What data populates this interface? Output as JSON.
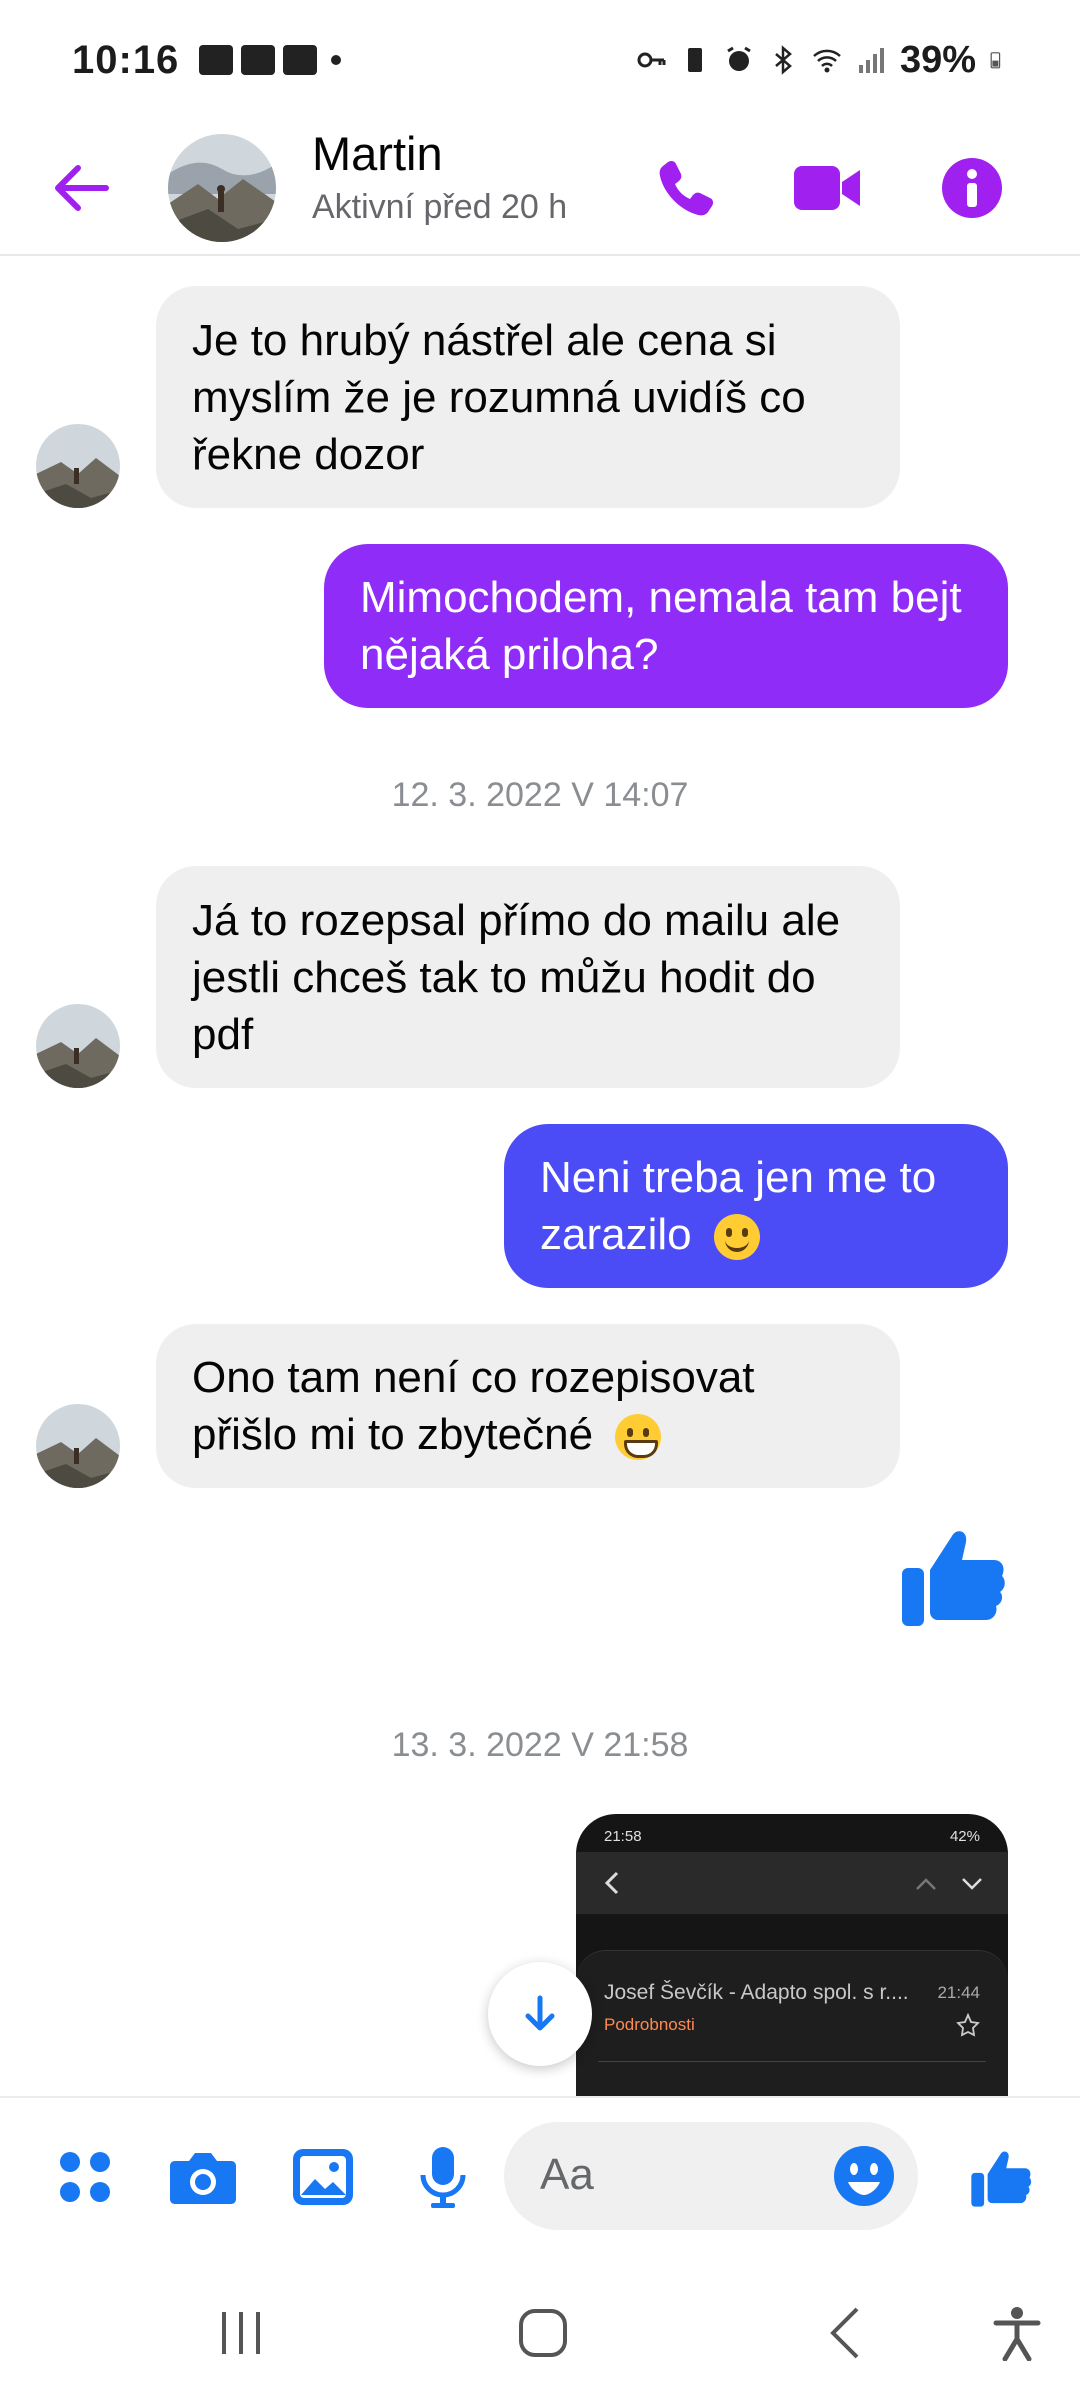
{
  "status_bar": {
    "time": "10:16",
    "battery": "39%"
  },
  "header": {
    "contact_name": "Martin",
    "contact_status": "Aktivní před 20 h",
    "accent_color": "#a020f0"
  },
  "messages": [
    {
      "direction": "incoming",
      "text": "Je to hrubý nástřel ale cena si myslím že je rozumná uvidíš co řekne dozor"
    },
    {
      "direction": "outgoing",
      "text": "Mimochodem, nemala tam bejt nějaká priloha?"
    },
    {
      "direction": "incoming",
      "text": "Já to rozepsal přímo do mailu ale jestli chceš tak to můžu hodit do pdf"
    },
    {
      "direction": "outgoing",
      "text": "Neni treba jen me to zarazilo",
      "emoji": "slightly-smiling-face"
    },
    {
      "direction": "incoming",
      "text": "Ono tam není co rozepisovat přišlo mi to zbytečné",
      "emoji": "grinning-face"
    },
    {
      "direction": "outgoing",
      "type": "like",
      "icon": "thumbs-up-icon"
    },
    {
      "direction": "outgoing",
      "type": "image-screenshot"
    }
  ],
  "timestamps": {
    "first": "12. 3. 2022 V 14:07",
    "second": "13. 3. 2022 V 21:58"
  },
  "screenshot_preview": {
    "status_time": "21:58",
    "status_battery": "42%",
    "sender": "Josef Ševčík - Adapto spol. s r....",
    "time": "21:44",
    "details_link": "Podrobnosti"
  },
  "composer": {
    "placeholder": "Aa",
    "icons": [
      "apps-icon",
      "camera-icon",
      "gallery-icon",
      "microphone-icon",
      "emoji-icon",
      "thumbs-up-icon"
    ]
  },
  "colors": {
    "outgoing_bubble_1": "#8f2cf7",
    "outgoing_bubble_2": "#4b4cf5",
    "incoming_bubble": "#efefef",
    "composer_icons": "#1877f2",
    "like": "#1877f2"
  }
}
